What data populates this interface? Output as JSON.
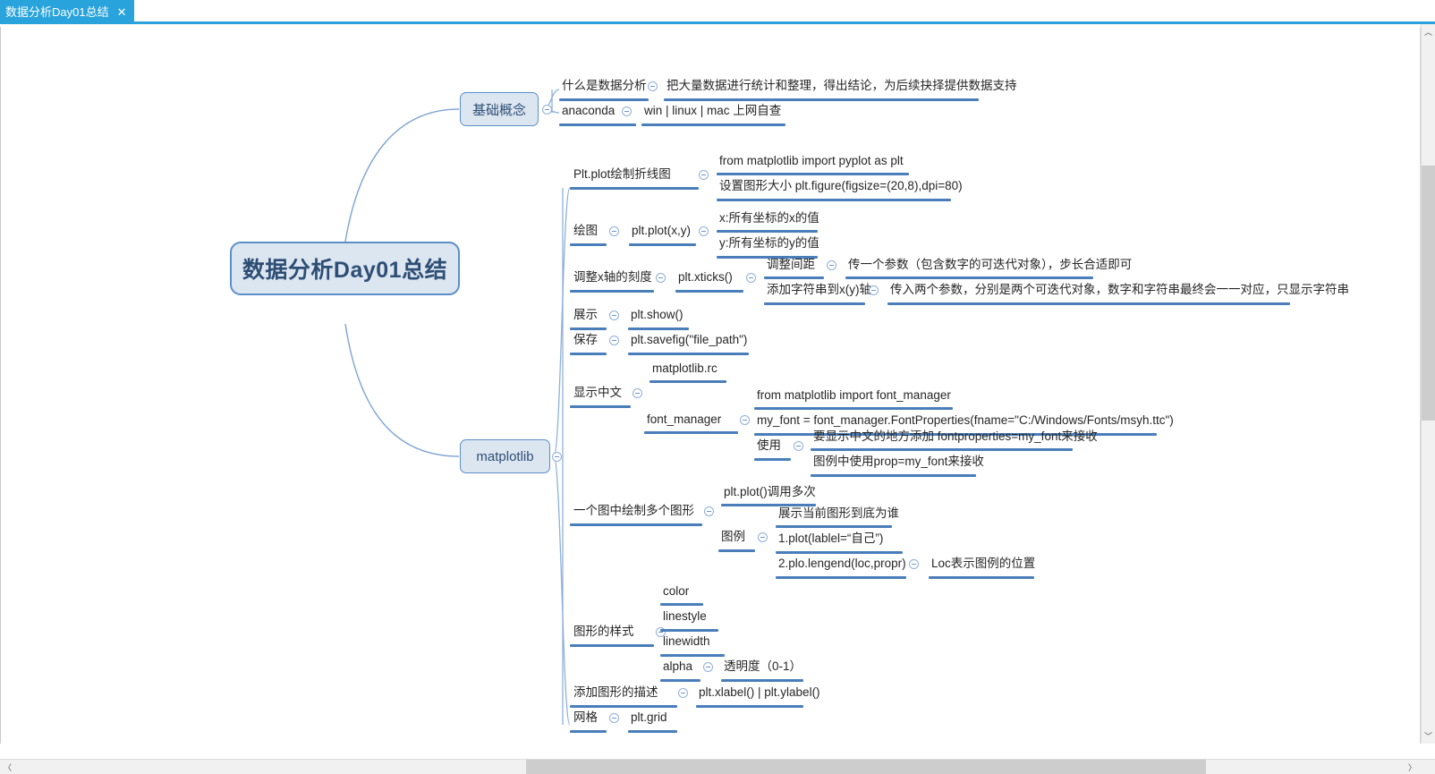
{
  "window": {
    "tab": {
      "title": "数据分析Day01总结",
      "close_label": "✕"
    },
    "accent_color": "#29a3dc",
    "node_fill": "#dce6f1",
    "node_border": "#5b8fc7",
    "branch_color": "#4a7ebb"
  },
  "scrollbars": {
    "vertical": {
      "up_arrow": "︿",
      "down_arrow": "﹀"
    },
    "horizontal": {
      "left_arrow": "〈",
      "right_arrow": "〉"
    }
  },
  "mindmap": {
    "root": "数据分析Day01总结",
    "branches": [
      {
        "label": "基础概念",
        "children": [
          {
            "label": "什么是数据分析",
            "children": [
              {
                "label": "把大量数据进行统计和整理，得出结论，为后续抉择提供数据支持"
              }
            ]
          },
          {
            "label": "anaconda",
            "children": [
              {
                "label": "win | linux | mac 上网自查"
              }
            ]
          }
        ]
      },
      {
        "label": "matplotlib",
        "children": [
          {
            "label": "Plt.plot绘制折线图",
            "children": [
              {
                "label": "from matplotlib import pyplot as plt"
              },
              {
                "label": "设置图形大小 plt.figure(figsize=(20,8),dpi=80)"
              }
            ]
          },
          {
            "label": "绘图",
            "children": [
              {
                "label": "plt.plot(x,y)",
                "children": [
                  {
                    "label": "x:所有坐标的x的值"
                  },
                  {
                    "label": "y:所有坐标的y的值"
                  }
                ]
              }
            ]
          },
          {
            "label": "调整x轴的刻度",
            "children": [
              {
                "label": "plt.xticks()",
                "children": [
                  {
                    "label": "调整间距",
                    "children": [
                      {
                        "label": "传一个参数（包含数字的可迭代对象），步长合适即可"
                      }
                    ]
                  },
                  {
                    "label": "添加字符串到x(y)轴",
                    "children": [
                      {
                        "label": "传入两个参数，分别是两个可迭代对象，数字和字符串最终会一一对应，只显示字符串"
                      }
                    ]
                  }
                ]
              }
            ]
          },
          {
            "label": "展示",
            "children": [
              {
                "label": "plt.show()"
              }
            ]
          },
          {
            "label": "保存",
            "children": [
              {
                "label": "plt.savefig(\"file_path\")"
              }
            ]
          },
          {
            "label": "显示中文",
            "children": [
              {
                "label": "matplotlib.rc"
              },
              {
                "label": "font_manager",
                "children": [
                  {
                    "label": "from matplotlib import font_manager"
                  },
                  {
                    "label": "my_font = font_manager.FontProperties(fname=\"C:/Windows/Fonts/msyh.ttc\")"
                  },
                  {
                    "label": "使用",
                    "children": [
                      {
                        "label": "要显示中文的地方添加 fontproperties=my_font来接收"
                      },
                      {
                        "label": "图例中使用prop=my_font来接收"
                      }
                    ]
                  }
                ]
              }
            ]
          },
          {
            "label": "一个图中绘制多个图形",
            "children": [
              {
                "label": "plt.plot()调用多次"
              },
              {
                "label": "图例",
                "children": [
                  {
                    "label": "展示当前图形到底为谁"
                  },
                  {
                    "label": "1.plot(lablel=“自己”)"
                  },
                  {
                    "label": "2.plo.lengend(loc,propr)",
                    "children": [
                      {
                        "label": "Loc表示图例的位置"
                      }
                    ]
                  }
                ]
              }
            ]
          },
          {
            "label": "图形的样式",
            "children": [
              {
                "label": "color"
              },
              {
                "label": "linestyle"
              },
              {
                "label": "linewidth"
              },
              {
                "label": "alpha",
                "children": [
                  {
                    "label": "透明度（0-1）"
                  }
                ]
              }
            ]
          },
          {
            "label": "添加图形的描述",
            "children": [
              {
                "label": "plt.xlabel() | plt.ylabel()"
              }
            ]
          },
          {
            "label": "网格",
            "children": [
              {
                "label": "plt.grid"
              }
            ]
          }
        ]
      }
    ]
  }
}
